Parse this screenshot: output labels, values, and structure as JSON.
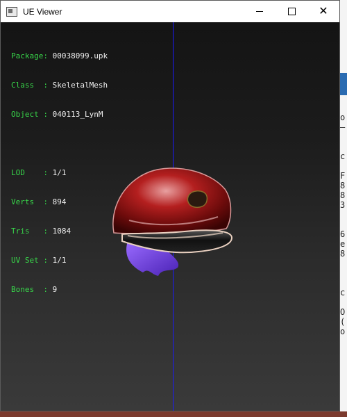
{
  "window": {
    "title": "UE Viewer",
    "controls": {
      "minimize_icon": "minimize-icon",
      "maximize_icon": "maximize-icon",
      "close_glyph": "✕"
    }
  },
  "info": {
    "package_key": "Package:",
    "package_value": "00038099.upk",
    "class_key": "Class  :",
    "class_value": "SkeletalMesh",
    "object_key": "Object :",
    "object_value": "040113_LynM",
    "lod_key": "LOD    :",
    "lod_value": "1/1",
    "verts_key": "Verts  :",
    "verts_value": "894",
    "tris_key": "Tris   :",
    "tris_value": "1084",
    "uvset_key": "UV Set :",
    "uvset_value": "1/1",
    "bones_key": "Bones  :",
    "bones_value": "9"
  },
  "colors": {
    "label_green": "#38d64a",
    "axis_blue": "#1a1aff",
    "viewport_bg": "#1f1f1f"
  },
  "background_right_chars": [
    "o",
    "—",
    "c",
    "F",
    "8",
    "8",
    "3",
    "6",
    "e",
    "8",
    "c",
    "O",
    "(",
    "o"
  ]
}
